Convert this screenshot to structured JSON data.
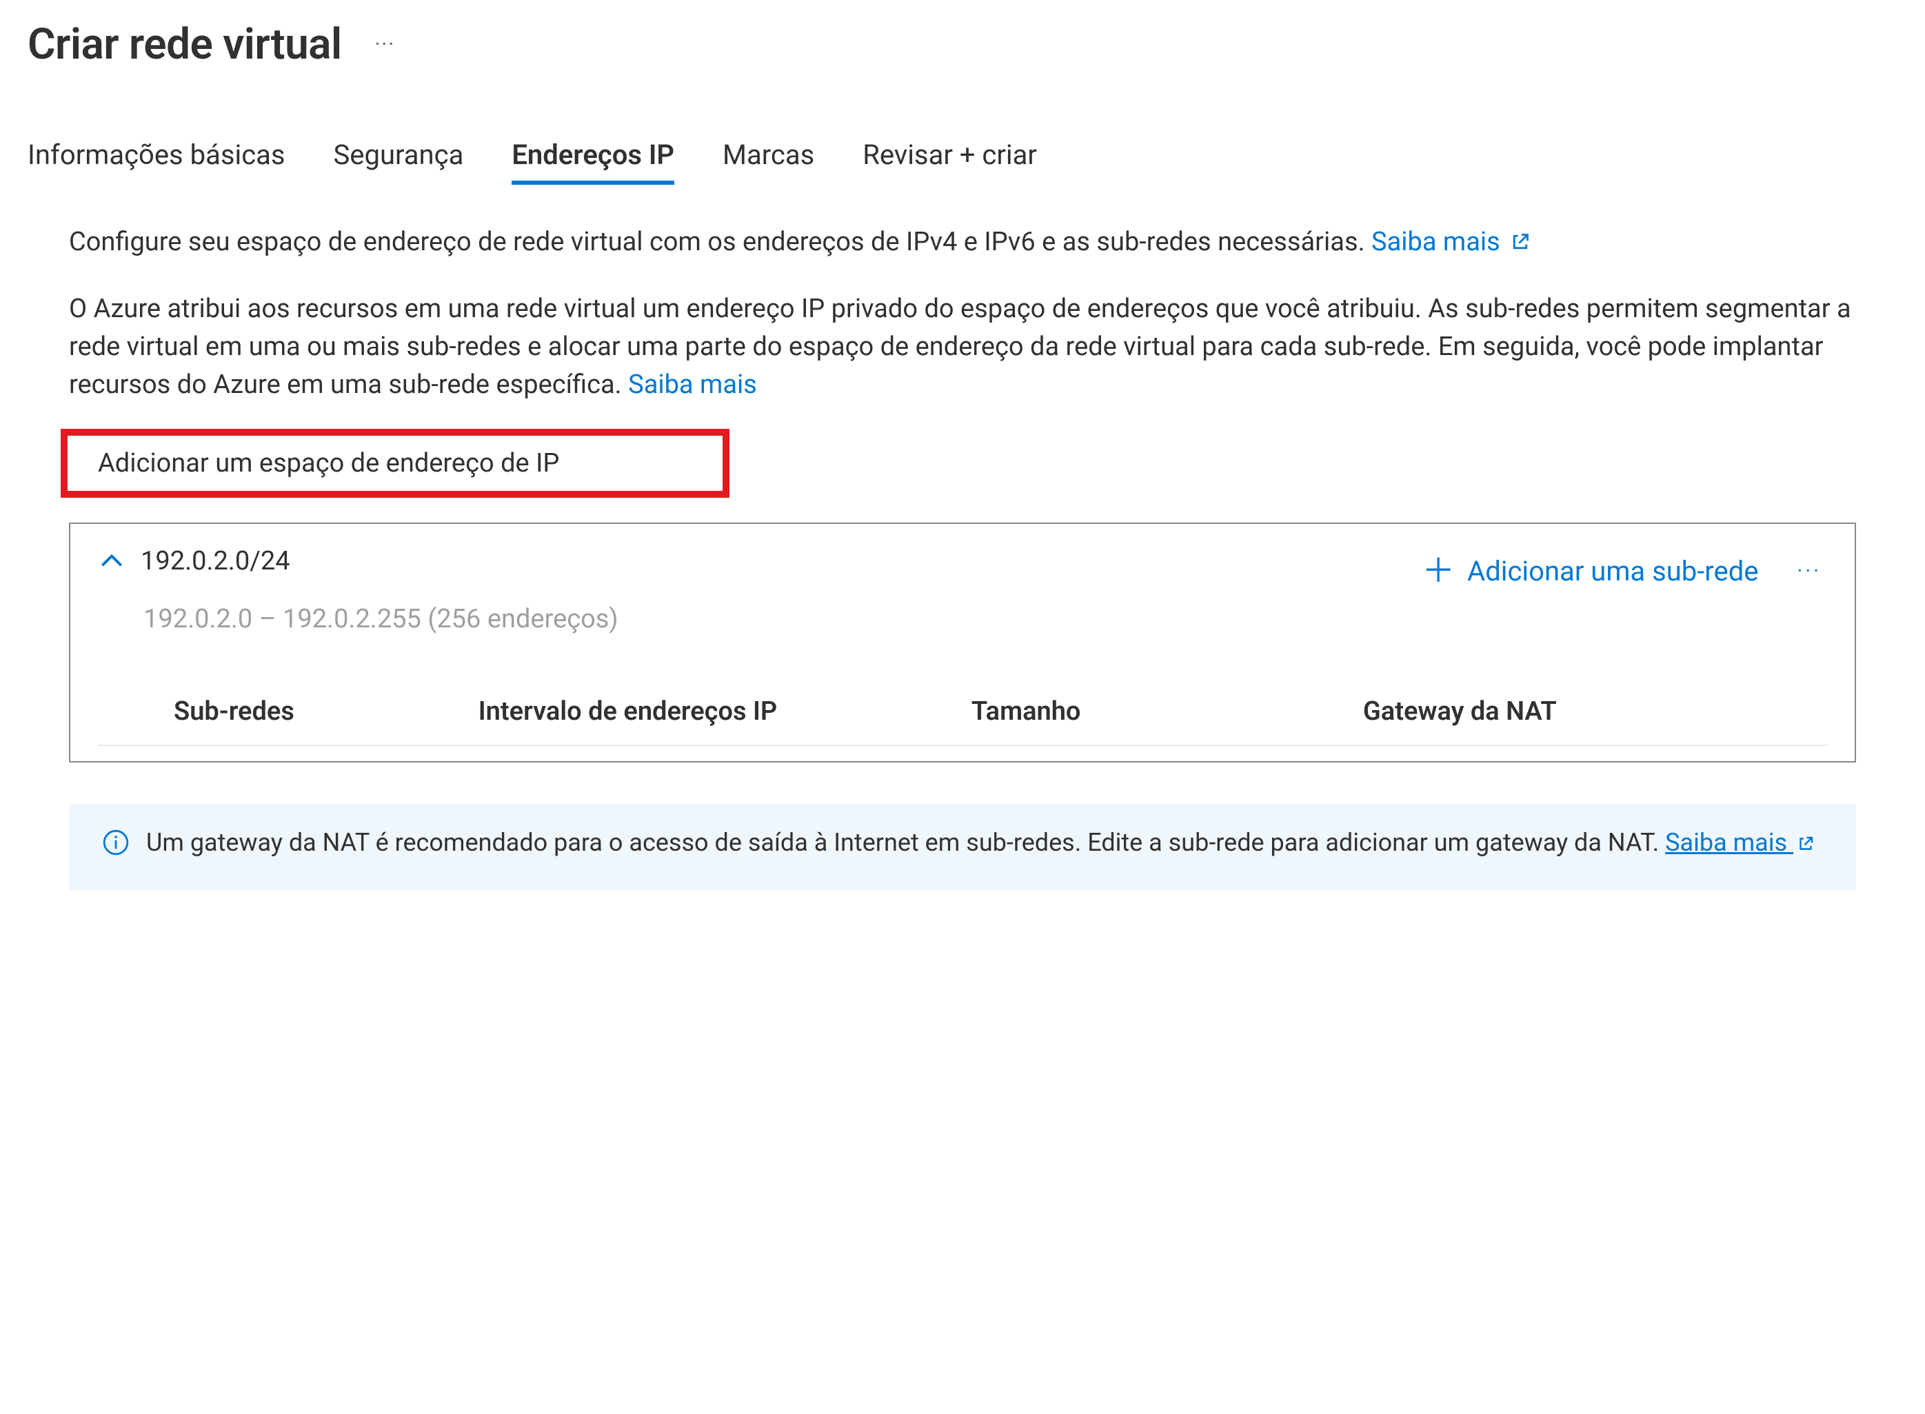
{
  "title": "Criar rede virtual",
  "tabs": [
    "Informações básicas",
    "Segurança",
    "Endereços IP",
    "Marcas",
    "Revisar + criar"
  ],
  "activeTabIndex": 2,
  "intro1_text": "Configure seu espaço de endereço de rede virtual com os endereços de IPv4 e IPv6 e as sub-redes necessárias. ",
  "intro1_link": "Saiba mais",
  "intro2_text": "O Azure atribui aos recursos em uma rede virtual um endereço IP privado do espaço de endereços que você atribuiu. As sub-redes permitem segmentar a rede virtual em uma ou mais sub-redes e alocar uma parte do espaço de endereço da rede virtual para cada sub-rede. Em seguida, você pode implantar recursos do Azure em uma sub-rede específica. ",
  "intro2_link": "Saiba mais",
  "add_space_label": "Adicionar um espaço de endereço de IP",
  "address_space": {
    "cidr": "192.0.2.0/24",
    "range_hint": "192.0.2.0 – 192.0.2.255 (256 endereços)",
    "add_subnet_label": "Adicionar uma sub-rede",
    "columns": [
      "Sub-redes",
      "Intervalo de endereços IP",
      "Tamanho",
      "Gateway da NAT"
    ]
  },
  "info_banner": {
    "text": "Um gateway da NAT é recomendado para o acesso de saída à Internet em sub-redes. Edite a sub-rede para adicionar um gateway da NAT. ",
    "link": "Saiba mais"
  }
}
